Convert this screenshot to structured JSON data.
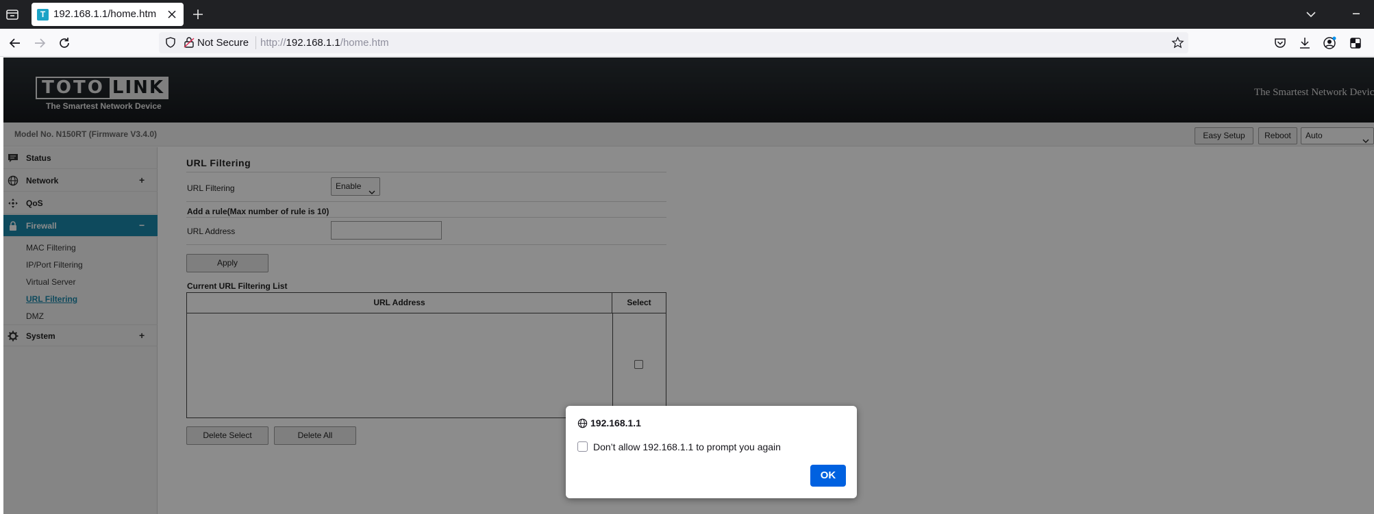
{
  "browser": {
    "tab_title": "192.168.1.1/home.htm",
    "tab_favicon_letter": "T",
    "security_label": "Not Secure",
    "url_prefix": "http://",
    "url_host": "192.168.1.1",
    "url_path": "/home.htm"
  },
  "banner": {
    "logo_left": "TOTO",
    "logo_right": "LINK",
    "logo_tagline": "The Smartest Network Device",
    "slogan": "The Smartest Network Device"
  },
  "modelbar": {
    "model": "Model No. N150RT (Firmware V3.4.0)",
    "easy_setup": "Easy Setup",
    "reboot": "Reboot",
    "language": "Auto"
  },
  "sidebar": {
    "items": [
      {
        "label": "Status",
        "toggle": ""
      },
      {
        "label": "Network",
        "toggle": "+"
      },
      {
        "label": "QoS",
        "toggle": ""
      },
      {
        "label": "Firewall",
        "toggle": "−"
      },
      {
        "label": "System",
        "toggle": "+"
      }
    ],
    "firewall_sub": [
      "MAC Filtering",
      "IP/Port Filtering",
      "Virtual Server",
      "URL Filtering",
      "DMZ"
    ],
    "active_item": "Firewall",
    "current_sub": "URL Filtering"
  },
  "content": {
    "title": "URL Filtering",
    "url_filtering_label": "URL Filtering",
    "url_filtering_value": "Enable",
    "add_rule_label": "Add a rule(Max number of rule is 10)",
    "url_address_label": "URL Address",
    "url_address_value": "",
    "apply_button": "Apply",
    "list_title": "Current URL Filtering List",
    "table_headers": [
      "URL Address",
      "Select"
    ],
    "delete_select_button": "Delete Select",
    "delete_all_button": "Delete All"
  },
  "dialog": {
    "title": "192.168.1.1",
    "checkbox_label": "Don’t allow 192.168.1.1 to prompt you again",
    "ok_button": "OK"
  },
  "colors": {
    "sidebar_active": "#1b87a9",
    "dialog_button": "#0061e0",
    "tabbar": "#202124"
  }
}
